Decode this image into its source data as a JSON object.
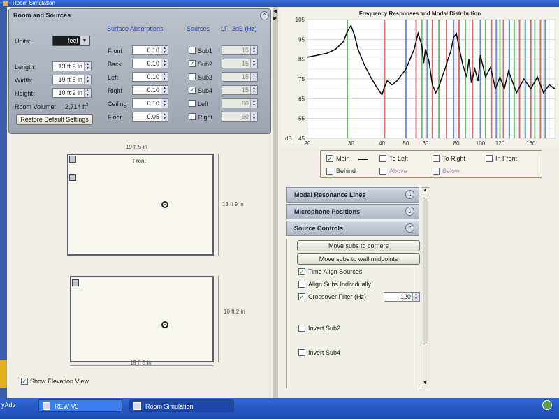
{
  "window": {
    "title": "Room Simulation"
  },
  "room_panel": {
    "title": "Room and Sources",
    "units_label": "Units:",
    "units_value": "feet",
    "length_label": "Length:",
    "length_value": "13 ft 9 in",
    "width_label": "Width:",
    "width_value": "19 ft 5 in",
    "height_label": "Height:",
    "height_value": "10 ft 2 in",
    "volume_label": "Room Volume:",
    "volume_value": "2,714 ft",
    "volume_unit_sup": "3",
    "restore_button": "Restore Default Settings",
    "absorptions_header": "Surface Absorptions",
    "absorptions": [
      {
        "label": "Front",
        "value": "0.10"
      },
      {
        "label": "Back",
        "value": "0.10"
      },
      {
        "label": "Left",
        "value": "0.10"
      },
      {
        "label": "Right",
        "value": "0.10"
      },
      {
        "label": "Ceiling",
        "value": "0.10"
      },
      {
        "label": "Floor",
        "value": "0.05"
      }
    ],
    "sources_header": "Sources",
    "lf_header": "LF -3dB (Hz)",
    "sources": [
      {
        "label": "Sub1",
        "checked": false,
        "lf": "15"
      },
      {
        "label": "Sub2",
        "checked": true,
        "lf": "15"
      },
      {
        "label": "Sub3",
        "checked": false,
        "lf": "15"
      },
      {
        "label": "Sub4",
        "checked": true,
        "lf": "15"
      },
      {
        "label": "Left",
        "checked": false,
        "lf": "60"
      },
      {
        "label": "Right",
        "checked": false,
        "lf": "60"
      }
    ]
  },
  "plan_view": {
    "top_dim": "19 ft 5 in",
    "side_dim": "13 ft 9 in",
    "front_label": "Front"
  },
  "elevation_view": {
    "side_dim": "10 ft 2 in",
    "bottom_dim": "19 ft 5 in"
  },
  "show_elevation": {
    "label": "Show Elevation View",
    "checked": true
  },
  "chart_data": {
    "type": "line",
    "title": "Frequency Responses and Modal Distribution",
    "ylabel": "dB",
    "x_scale": "log",
    "xlim": [
      20,
      200
    ],
    "ylim": [
      45,
      105
    ],
    "x_ticks": [
      "20",
      "30",
      "40",
      "50",
      "60",
      "80",
      "100",
      "120",
      "160"
    ],
    "y_ticks": [
      "45",
      "55",
      "65",
      "75",
      "85",
      "95",
      "105"
    ],
    "series": [
      {
        "name": "Main",
        "x": [
          20,
          22,
          24,
          26,
          28,
          29,
          30,
          31,
          32,
          34,
          36,
          38,
          40,
          41,
          42,
          44,
          46,
          48,
          50,
          52,
          54,
          56,
          58,
          59,
          60,
          62,
          64,
          66,
          68,
          70,
          72,
          74,
          76,
          78,
          80,
          82,
          85,
          88,
          90,
          92,
          95,
          98,
          100,
          105,
          110,
          115,
          120,
          125,
          130,
          140,
          150,
          160,
          170,
          180,
          190,
          200
        ],
        "values": [
          86,
          87,
          88,
          90,
          94,
          99,
          102,
          97,
          90,
          82,
          76,
          71,
          67,
          71,
          74,
          72,
          74,
          77,
          80,
          85,
          90,
          98,
          92,
          83,
          90,
          84,
          72,
          68,
          71,
          76,
          80,
          85,
          89,
          96,
          98,
          91,
          82,
          76,
          85,
          73,
          80,
          74,
          87,
          76,
          81,
          70,
          76,
          70,
          79,
          68,
          75,
          70,
          76,
          68,
          72,
          70
        ]
      }
    ],
    "modal_lines": [
      {
        "freq": 29,
        "color": "#3fa43f"
      },
      {
        "freq": 41,
        "color": "#c84040"
      },
      {
        "freq": 50,
        "color": "#3a6fd0"
      },
      {
        "freq": 55,
        "color": "#c84040"
      },
      {
        "freq": 58,
        "color": "#3fa43f"
      },
      {
        "freq": 61,
        "color": "#3a6fd0"
      },
      {
        "freq": 64,
        "color": "#c84040"
      },
      {
        "freq": 68,
        "color": "#3fa43f"
      },
      {
        "freq": 73,
        "color": "#c84040"
      },
      {
        "freq": 78,
        "color": "#3a6fd0"
      },
      {
        "freq": 82,
        "color": "#c84040"
      },
      {
        "freq": 87,
        "color": "#3fa43f"
      },
      {
        "freq": 93,
        "color": "#c84040"
      },
      {
        "freq": 100,
        "color": "#3a6fd0"
      },
      {
        "freq": 105,
        "color": "#3fa43f"
      },
      {
        "freq": 111,
        "color": "#c84040"
      },
      {
        "freq": 116,
        "color": "#3a6fd0"
      },
      {
        "freq": 120,
        "color": "#3fa43f"
      },
      {
        "freq": 124,
        "color": "#c84040"
      },
      {
        "freq": 131,
        "color": "#3a6fd0"
      },
      {
        "freq": 137,
        "color": "#3fa43f"
      },
      {
        "freq": 144,
        "color": "#c84040"
      },
      {
        "freq": 152,
        "color": "#3a6fd0"
      },
      {
        "freq": 160,
        "color": "#c84040"
      },
      {
        "freq": 166,
        "color": "#3fa43f"
      },
      {
        "freq": 175,
        "color": "#c84040"
      },
      {
        "freq": 183,
        "color": "#3a6fd0"
      }
    ]
  },
  "legend": {
    "items": [
      {
        "label": "Main",
        "checked": true,
        "enabled": true
      },
      {
        "label": "To Left",
        "checked": false,
        "enabled": true
      },
      {
        "label": "To Right",
        "checked": false,
        "enabled": true
      },
      {
        "label": "In Front",
        "checked": false,
        "enabled": true
      },
      {
        "label": "Behind",
        "checked": false,
        "enabled": true
      },
      {
        "label": "Above",
        "checked": false,
        "enabled": false
      },
      {
        "label": "Below",
        "checked": false,
        "enabled": false
      }
    ]
  },
  "accordion": {
    "modal": "Modal Resonance Lines",
    "mic": "Microphone Positions",
    "source": "Source Controls"
  },
  "source_controls": {
    "move_corners": "Move subs to corners",
    "move_midpoints": "Move subs to wall midpoints",
    "time_align": {
      "label": "Time Align Sources",
      "checked": true
    },
    "align_individually": {
      "label": "Align Subs Individually",
      "checked": false
    },
    "crossover": {
      "label": "Crossover Filter (Hz)",
      "checked": true,
      "value": "120"
    },
    "invert_sub2": {
      "label": "Invert Sub2",
      "checked": false
    },
    "invert_sub4": {
      "label": "Invert Sub4",
      "checked": false
    }
  },
  "taskbar": {
    "left_text": "yAdv",
    "tasks": [
      {
        "label": "REW V5",
        "active": false
      },
      {
        "label": "Room Simulation",
        "active": true
      }
    ]
  }
}
